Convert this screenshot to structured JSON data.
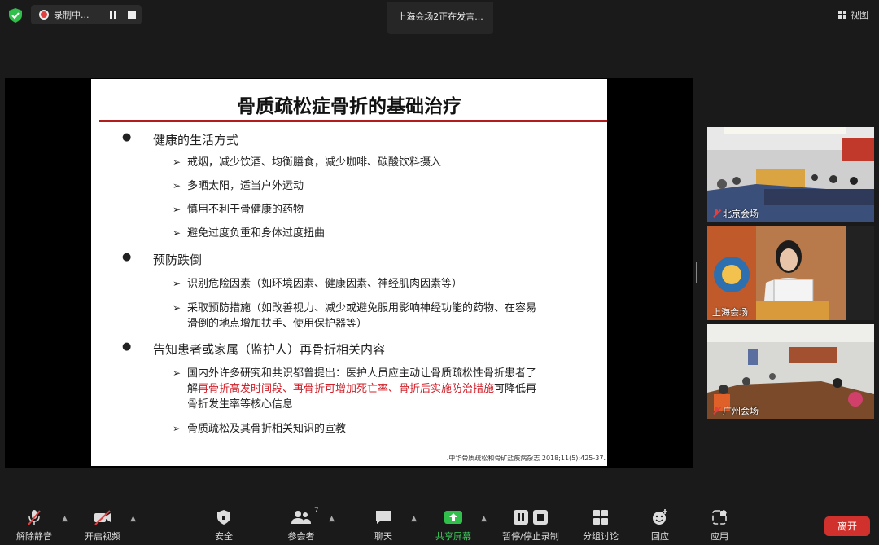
{
  "topbar": {
    "recording_label": "录制中...",
    "speaking_status": "上海会场2正在发言...",
    "view_label": "视图"
  },
  "slide": {
    "title": "骨质疏松症骨折的基础治疗",
    "sections": [
      {
        "heading": "健康的生活方式",
        "items": [
          "戒烟，减少饮酒、均衡膳食，减少咖啡、碳酸饮料摄入",
          "多晒太阳，适当户外运动",
          "慎用不利于骨健康的药物",
          "避免过度负重和身体过度扭曲"
        ]
      },
      {
        "heading": "预防跌倒",
        "items": [
          "识别危险因素（如环境因素、健康因素、神经肌肉因素等）",
          "采取预防措施（如改善视力、减少或避免服用影响神经功能的药物、在容易",
          "滑倒的地点增加扶手、使用保护器等）"
        ]
      },
      {
        "heading": "告知患者或家属（监护人）再骨折相关内容",
        "item1_part1": "国内外许多研究和共识都曾提出：医护人员应主动让骨质疏松性骨折患者了",
        "item1_part2": "解",
        "item1_red": "再骨折高发时间段、再骨折可增加死亡率、骨折后实施防治措施",
        "item1_part3": "可降低再",
        "item1_part4": "骨折发生率等核心信息",
        "item2": "骨质疏松及其骨折相关知识的宣教"
      }
    ],
    "citation": ".中华骨质疏松和骨矿盐疾病杂志 2018;11(5):425-37."
  },
  "tiles": [
    {
      "label": "北京会场"
    },
    {
      "label": "上海会场"
    },
    {
      "label": "广州会场"
    }
  ],
  "toolbar": {
    "unmute": "解除静音",
    "start_video": "开启视频",
    "security": "安全",
    "participants": "参会者",
    "participant_count": "7",
    "chat": "聊天",
    "share": "共享屏幕",
    "record": "暂停/停止录制",
    "breakout": "分组讨论",
    "reactions": "回应",
    "apps": "应用",
    "leave": "离开"
  },
  "colors": {
    "accent_red": "#d0312d",
    "share_green": "#3fcf5e",
    "slide_rule": "#b11c1c"
  }
}
